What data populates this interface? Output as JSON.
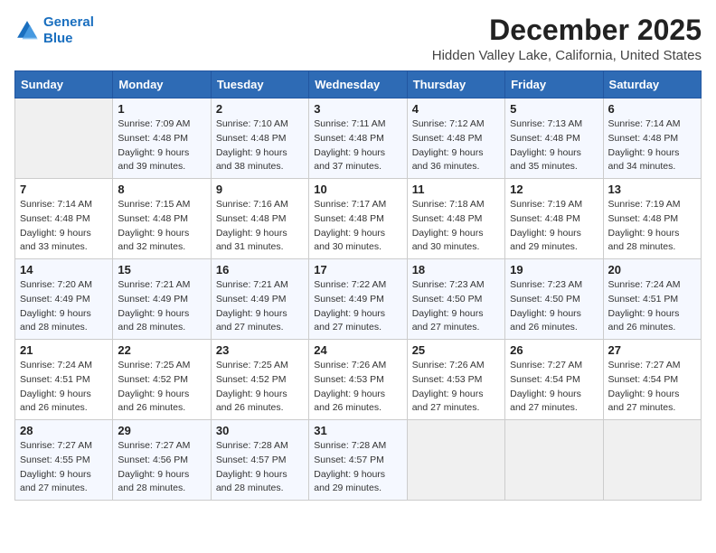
{
  "logo": {
    "line1": "General",
    "line2": "Blue"
  },
  "title": "December 2025",
  "location": "Hidden Valley Lake, California, United States",
  "days_of_week": [
    "Sunday",
    "Monday",
    "Tuesday",
    "Wednesday",
    "Thursday",
    "Friday",
    "Saturday"
  ],
  "weeks": [
    [
      {
        "day": "",
        "info": ""
      },
      {
        "day": "1",
        "info": "Sunrise: 7:09 AM\nSunset: 4:48 PM\nDaylight: 9 hours\nand 39 minutes."
      },
      {
        "day": "2",
        "info": "Sunrise: 7:10 AM\nSunset: 4:48 PM\nDaylight: 9 hours\nand 38 minutes."
      },
      {
        "day": "3",
        "info": "Sunrise: 7:11 AM\nSunset: 4:48 PM\nDaylight: 9 hours\nand 37 minutes."
      },
      {
        "day": "4",
        "info": "Sunrise: 7:12 AM\nSunset: 4:48 PM\nDaylight: 9 hours\nand 36 minutes."
      },
      {
        "day": "5",
        "info": "Sunrise: 7:13 AM\nSunset: 4:48 PM\nDaylight: 9 hours\nand 35 minutes."
      },
      {
        "day": "6",
        "info": "Sunrise: 7:14 AM\nSunset: 4:48 PM\nDaylight: 9 hours\nand 34 minutes."
      }
    ],
    [
      {
        "day": "7",
        "info": "Sunrise: 7:14 AM\nSunset: 4:48 PM\nDaylight: 9 hours\nand 33 minutes."
      },
      {
        "day": "8",
        "info": "Sunrise: 7:15 AM\nSunset: 4:48 PM\nDaylight: 9 hours\nand 32 minutes."
      },
      {
        "day": "9",
        "info": "Sunrise: 7:16 AM\nSunset: 4:48 PM\nDaylight: 9 hours\nand 31 minutes."
      },
      {
        "day": "10",
        "info": "Sunrise: 7:17 AM\nSunset: 4:48 PM\nDaylight: 9 hours\nand 30 minutes."
      },
      {
        "day": "11",
        "info": "Sunrise: 7:18 AM\nSunset: 4:48 PM\nDaylight: 9 hours\nand 30 minutes."
      },
      {
        "day": "12",
        "info": "Sunrise: 7:19 AM\nSunset: 4:48 PM\nDaylight: 9 hours\nand 29 minutes."
      },
      {
        "day": "13",
        "info": "Sunrise: 7:19 AM\nSunset: 4:48 PM\nDaylight: 9 hours\nand 28 minutes."
      }
    ],
    [
      {
        "day": "14",
        "info": "Sunrise: 7:20 AM\nSunset: 4:49 PM\nDaylight: 9 hours\nand 28 minutes."
      },
      {
        "day": "15",
        "info": "Sunrise: 7:21 AM\nSunset: 4:49 PM\nDaylight: 9 hours\nand 28 minutes."
      },
      {
        "day": "16",
        "info": "Sunrise: 7:21 AM\nSunset: 4:49 PM\nDaylight: 9 hours\nand 27 minutes."
      },
      {
        "day": "17",
        "info": "Sunrise: 7:22 AM\nSunset: 4:49 PM\nDaylight: 9 hours\nand 27 minutes."
      },
      {
        "day": "18",
        "info": "Sunrise: 7:23 AM\nSunset: 4:50 PM\nDaylight: 9 hours\nand 27 minutes."
      },
      {
        "day": "19",
        "info": "Sunrise: 7:23 AM\nSunset: 4:50 PM\nDaylight: 9 hours\nand 26 minutes."
      },
      {
        "day": "20",
        "info": "Sunrise: 7:24 AM\nSunset: 4:51 PM\nDaylight: 9 hours\nand 26 minutes."
      }
    ],
    [
      {
        "day": "21",
        "info": "Sunrise: 7:24 AM\nSunset: 4:51 PM\nDaylight: 9 hours\nand 26 minutes."
      },
      {
        "day": "22",
        "info": "Sunrise: 7:25 AM\nSunset: 4:52 PM\nDaylight: 9 hours\nand 26 minutes."
      },
      {
        "day": "23",
        "info": "Sunrise: 7:25 AM\nSunset: 4:52 PM\nDaylight: 9 hours\nand 26 minutes."
      },
      {
        "day": "24",
        "info": "Sunrise: 7:26 AM\nSunset: 4:53 PM\nDaylight: 9 hours\nand 26 minutes."
      },
      {
        "day": "25",
        "info": "Sunrise: 7:26 AM\nSunset: 4:53 PM\nDaylight: 9 hours\nand 27 minutes."
      },
      {
        "day": "26",
        "info": "Sunrise: 7:27 AM\nSunset: 4:54 PM\nDaylight: 9 hours\nand 27 minutes."
      },
      {
        "day": "27",
        "info": "Sunrise: 7:27 AM\nSunset: 4:54 PM\nDaylight: 9 hours\nand 27 minutes."
      }
    ],
    [
      {
        "day": "28",
        "info": "Sunrise: 7:27 AM\nSunset: 4:55 PM\nDaylight: 9 hours\nand 27 minutes."
      },
      {
        "day": "29",
        "info": "Sunrise: 7:27 AM\nSunset: 4:56 PM\nDaylight: 9 hours\nand 28 minutes."
      },
      {
        "day": "30",
        "info": "Sunrise: 7:28 AM\nSunset: 4:57 PM\nDaylight: 9 hours\nand 28 minutes."
      },
      {
        "day": "31",
        "info": "Sunrise: 7:28 AM\nSunset: 4:57 PM\nDaylight: 9 hours\nand 29 minutes."
      },
      {
        "day": "",
        "info": ""
      },
      {
        "day": "",
        "info": ""
      },
      {
        "day": "",
        "info": ""
      }
    ]
  ]
}
